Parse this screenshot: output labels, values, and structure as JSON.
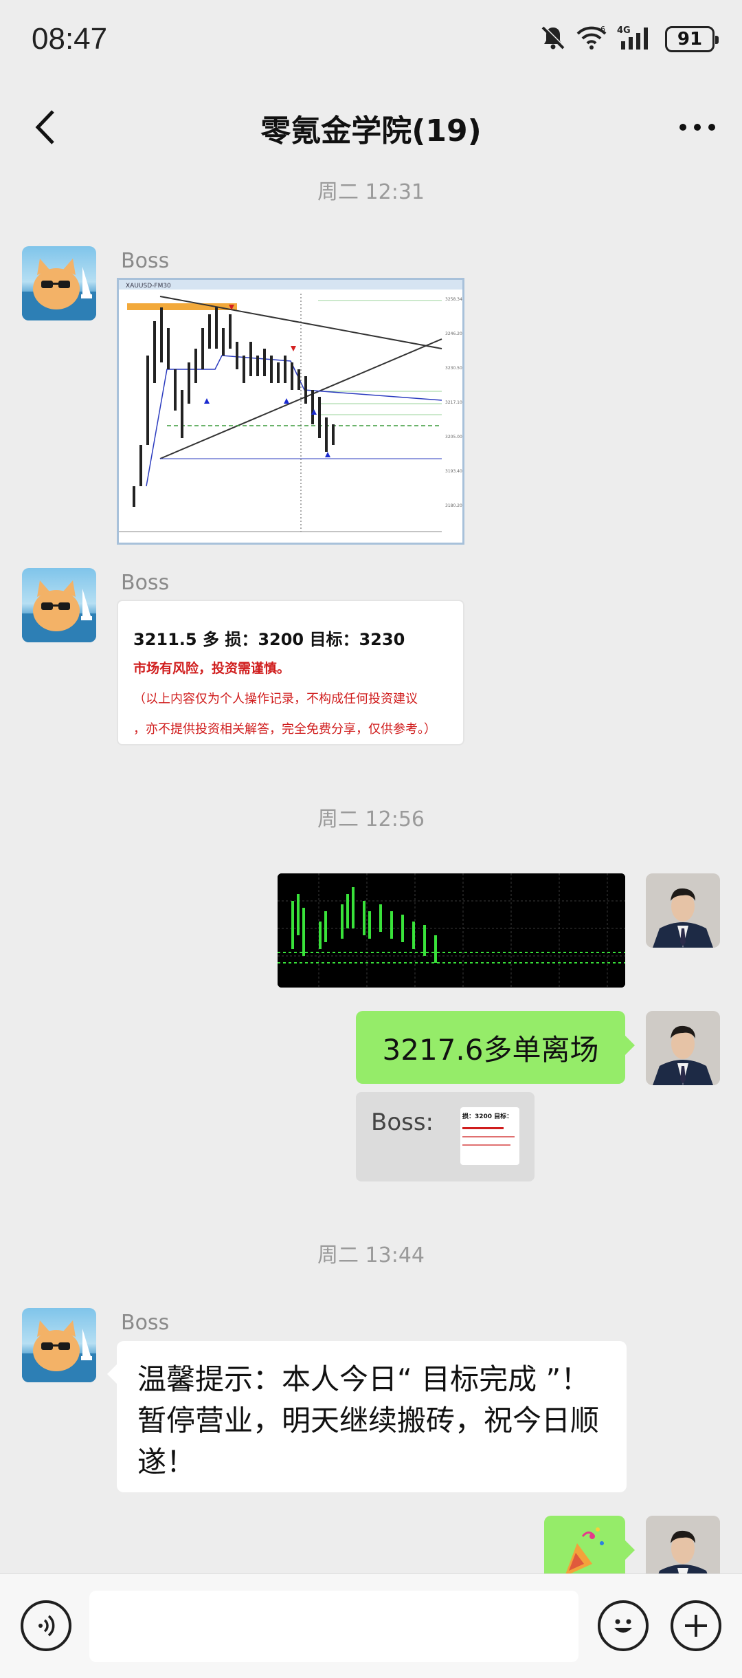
{
  "status": {
    "time": "08:47",
    "battery": "91",
    "signal_label": "4G"
  },
  "header": {
    "title": "零氪金学院(19)"
  },
  "messages": {
    "ts1": "周二 12:31",
    "ts2": "周二 12:56",
    "ts3": "周二 13:44",
    "boss_name": "Boss",
    "chart_caption": "XAUUSD-FM30",
    "trade_card": {
      "line1": "3211.5 多   损：3200  目标：3230",
      "line2": "市场有风险，投资需谨慎。",
      "line3": "（以上内容仅为个人操作记录，不构成任何投资建议",
      "line4": "，亦不提供投资相关解答，完全免费分享，仅供参考。）"
    },
    "exit_text": "3217.6多单离场",
    "quote_sender": "Boss:",
    "quote_thumb_text": "损：3200 目标：",
    "notice_text": "温馨提示：本人今日“ 目标完成 ”！暂停营业，明天继续搬砖，祝今日顺遂！"
  },
  "icons": [
    "back-icon",
    "more-icon",
    "voice-icon",
    "emoji-icon",
    "add-icon",
    "mute-icon",
    "wifi-icon",
    "signal-icon",
    "party-popper-icon"
  ]
}
